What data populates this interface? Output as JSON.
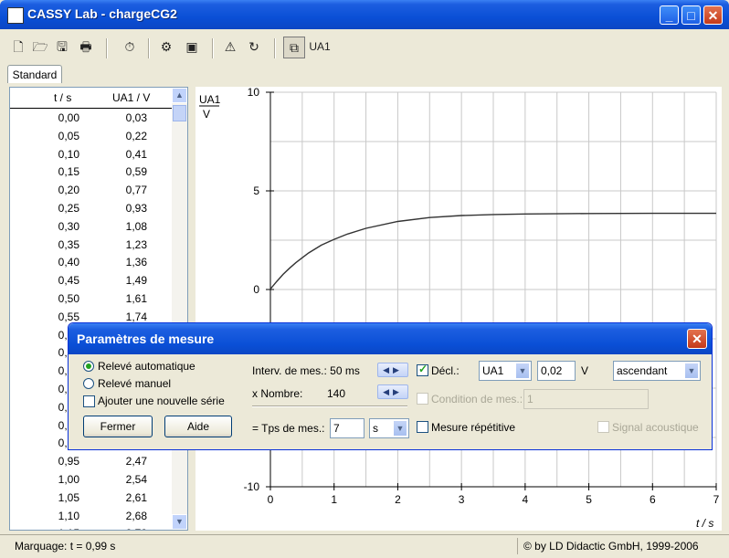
{
  "window": {
    "title": "CASSY Lab - chargeCG2",
    "minimize": "_",
    "maximize": "□",
    "close": "✕"
  },
  "toolbar": {
    "buttons": [
      {
        "name": "new-icon",
        "glyph": "🗋"
      },
      {
        "name": "open-icon",
        "glyph": "🗁"
      },
      {
        "name": "save-icon",
        "glyph": "🖫"
      },
      {
        "name": "print-icon",
        "glyph": "🖶"
      },
      {
        "name": "stopwatch-icon",
        "glyph": "⏱"
      },
      {
        "name": "settings-icon",
        "glyph": "⚙"
      },
      {
        "name": "display-icon",
        "glyph": "▣"
      },
      {
        "name": "alarm-icon",
        "glyph": "⚠"
      },
      {
        "name": "rotate-icon",
        "glyph": "↻"
      },
      {
        "name": "window-icon",
        "glyph": "⧉"
      }
    ],
    "ua1_label": "UA1"
  },
  "tabs": [
    {
      "label": "Standard"
    }
  ],
  "table": {
    "col1_header": "t / s",
    "col2_header": "UA1 / V",
    "rows": [
      [
        "0,00",
        "0,03"
      ],
      [
        "0,05",
        "0,22"
      ],
      [
        "0,10",
        "0,41"
      ],
      [
        "0,15",
        "0,59"
      ],
      [
        "0,20",
        "0,77"
      ],
      [
        "0,25",
        "0,93"
      ],
      [
        "0,30",
        "1,08"
      ],
      [
        "0,35",
        "1,23"
      ],
      [
        "0,40",
        "1,36"
      ],
      [
        "0,45",
        "1,49"
      ],
      [
        "0,50",
        "1,61"
      ],
      [
        "0,55",
        "1,74"
      ],
      [
        "0,60",
        ""
      ],
      [
        "0,65",
        ""
      ],
      [
        "0,70",
        ""
      ],
      [
        "0,75",
        ""
      ],
      [
        "0,80",
        ""
      ],
      [
        "0,85",
        ""
      ],
      [
        "0,90",
        ""
      ],
      [
        "0,95",
        "2,47"
      ],
      [
        "1,00",
        "2,54"
      ],
      [
        "1,05",
        "2,61"
      ],
      [
        "1,10",
        "2,68"
      ],
      [
        "1,15",
        "2,73"
      ]
    ]
  },
  "chart_data": {
    "type": "line",
    "ylabel": "UA1",
    "yunit": "V",
    "xlabel": "t / s",
    "xlim": [
      0,
      7
    ],
    "ylim": [
      -10,
      10
    ],
    "xticks": [
      "0",
      "1",
      "2",
      "3",
      "4",
      "5",
      "6",
      "7"
    ],
    "yticks": [
      {
        "v": 10,
        "label": "10"
      },
      {
        "v": 5,
        "label": "5"
      },
      {
        "v": 0,
        "label": "0"
      },
      {
        "v": -10,
        "label": "-10"
      }
    ],
    "grid": true,
    "series": [
      {
        "x": [
          0,
          0.1,
          0.2,
          0.3,
          0.4,
          0.5,
          0.6,
          0.8,
          1.0,
          1.2,
          1.5,
          2.0,
          2.5,
          3.0,
          3.5,
          4.0,
          5.0,
          6.0,
          7.0
        ],
        "values": [
          0.03,
          0.41,
          0.77,
          1.08,
          1.36,
          1.61,
          1.85,
          2.25,
          2.54,
          2.8,
          3.1,
          3.45,
          3.65,
          3.75,
          3.8,
          3.83,
          3.85,
          3.86,
          3.86
        ]
      }
    ]
  },
  "status": {
    "left": "Marquage:  t = 0,99 s",
    "right": "© by LD Didactic GmbH, 1999-2006"
  },
  "dialog": {
    "title": "Paramètres de mesure",
    "close": "✕",
    "radio_auto": "Relevé automatique",
    "radio_manual": "Relevé manuel",
    "add_series": "Ajouter une nouvelle série",
    "btn_close": "Fermer",
    "btn_help": "Aide",
    "interval_label": "Interv. de mes.: 50 ms",
    "count_label": "x Nombre:",
    "count_value": "140",
    "time_label": "= Tps de mes.:",
    "time_value": "7",
    "time_unit": "s",
    "trigger_label": "Décl.:",
    "trigger_channel": "UA1",
    "trigger_value": "0,02",
    "trigger_unit": "V",
    "trigger_direction": "ascendant",
    "condition_label": "Condition de mes.:",
    "condition_value": "1",
    "repeat_label": "Mesure répétitive",
    "acoustic_label": "Signal acoustique"
  }
}
